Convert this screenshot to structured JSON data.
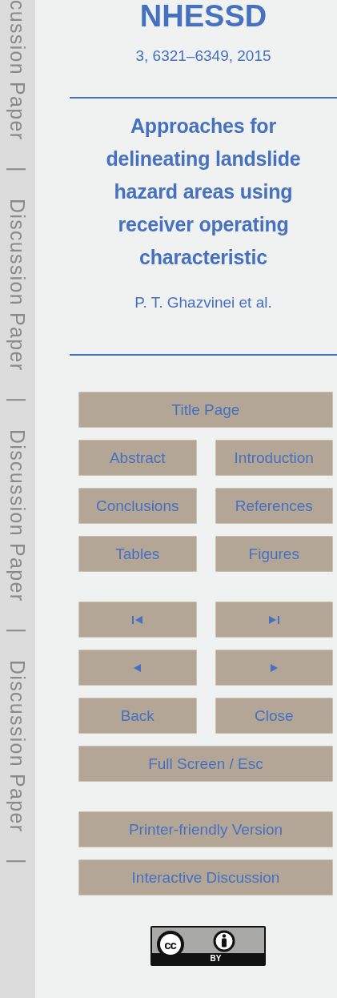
{
  "margin_labels": [
    {
      "kind": "text",
      "text": "cussion Paper"
    },
    {
      "kind": "separator",
      "text": "|"
    },
    {
      "kind": "text",
      "text": "Discussion Paper"
    },
    {
      "kind": "separator",
      "text": "|"
    },
    {
      "kind": "text",
      "text": "Discussion Paper"
    },
    {
      "kind": "separator",
      "text": "|"
    },
    {
      "kind": "text",
      "text": "Discussion Paper"
    },
    {
      "kind": "separator",
      "text": "|"
    }
  ],
  "journal": "NHESSD",
  "citation": "3, 6321–6349, 2015",
  "title": "Approaches for\ndelineating landslide\nhazard areas using\nreceiver operating\ncharacteristic",
  "authors": "P. T. Ghazvinei et al.",
  "nav_groups": [
    [
      [
        {
          "kind": "text",
          "label": "Title Page"
        }
      ],
      [
        {
          "kind": "text",
          "label": "Abstract"
        },
        {
          "kind": "text",
          "label": "Introduction"
        }
      ],
      [
        {
          "kind": "text",
          "label": "Conclusions"
        },
        {
          "kind": "text",
          "label": "References"
        }
      ],
      [
        {
          "kind": "text",
          "label": "Tables"
        },
        {
          "kind": "text",
          "label": "Figures"
        }
      ]
    ],
    [
      [
        {
          "kind": "icon"
        },
        {
          "kind": "icon"
        }
      ],
      [
        {
          "kind": "icon"
        },
        {
          "kind": "icon"
        }
      ],
      [
        {
          "kind": "text",
          "label": "Back"
        },
        {
          "kind": "text",
          "label": "Close"
        }
      ],
      [
        {
          "kind": "text",
          "label": "Full Screen / Esc"
        }
      ]
    ],
    [
      [
        {
          "kind": "text",
          "label": "Printer-friendly Version"
        }
      ],
      [
        {
          "kind": "text",
          "label": "Interactive Discussion"
        }
      ]
    ]
  ],
  "license": {
    "logo": "cc",
    "badge_text": "BY"
  }
}
